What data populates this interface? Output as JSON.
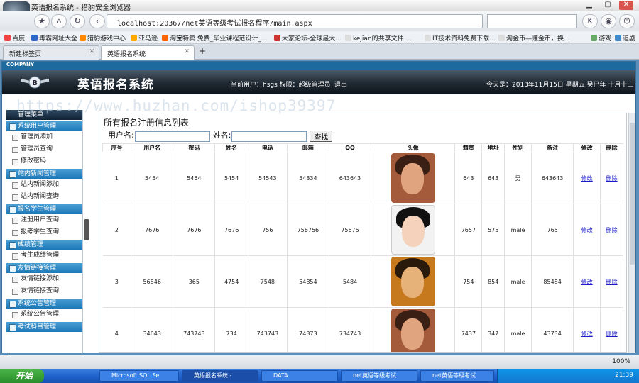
{
  "browser": {
    "window_title": "英语报名系统 - 猎豹安全浏览器",
    "url": "localhost:20367/net英语等级考试报名程序/main.aspx",
    "bookmarks": [
      "百度",
      "毒霸网址大全",
      "猎豹游戏中心",
      "亚马逊",
      "淘宝特卖 免费_毕业课程范设计_...",
      "大家论坛-全球最大...",
      "kejian的共享文件 ...",
      "IT技术资料免费下载...",
      "淘金币—赚金币，换...",
      "游戏",
      "追剧"
    ],
    "tabs": [
      {
        "label": "新建标签页",
        "active": false
      },
      {
        "label": "英语报名系统",
        "active": true
      }
    ],
    "zoom": "100%"
  },
  "app": {
    "brand_bar": "COMPANY",
    "title": "英语报名系统",
    "current_user": "当前用户：hsgs 权限：超级管理员",
    "logout": "退出",
    "date": "今天是：2013年11月15日 星期五 癸巳年 十月十三",
    "watermark": "https://www.huzhan.com/ishop39397"
  },
  "sidebar": {
    "title": "管理菜单",
    "sections": [
      {
        "title": "系统用户管理",
        "items": [
          "管理员添加",
          "管理员查询",
          "修改密码"
        ]
      },
      {
        "title": "站内新闻管理",
        "items": [
          "站内新闻添加",
          "站内新闻查询"
        ]
      },
      {
        "title": "报名学生管理",
        "items": [
          "注册用户查询",
          "报考学生查询"
        ]
      },
      {
        "title": "成绩管理",
        "items": [
          "考生成绩管理"
        ]
      },
      {
        "title": "友情链接管理",
        "items": [
          "友情链接添加",
          "友情链接查询"
        ]
      },
      {
        "title": "系统公告管理",
        "items": [
          "系统公告管理"
        ]
      },
      {
        "title": "考试科目管理",
        "items": []
      }
    ]
  },
  "main": {
    "heading": "所有报名注册信息列表",
    "search": {
      "username_label": "用户名:",
      "name_label": "姓名:",
      "button": "查找"
    },
    "columns": [
      "序号",
      "用户名",
      "密码",
      "姓名",
      "电话",
      "邮箱",
      "QQ",
      "头像",
      "籍贯",
      "地址",
      "性别",
      "备注",
      "修改",
      "删除"
    ],
    "rows": [
      [
        "1",
        "5454",
        "5454",
        "5454",
        "54543",
        "54334",
        "643643",
        "",
        "643",
        "643",
        "男",
        "643643",
        "修改",
        "删除"
      ],
      [
        "2",
        "7676",
        "7676",
        "7676",
        "756",
        "756756",
        "75675",
        "",
        "7657",
        "575",
        "male",
        "765",
        "修改",
        "删除"
      ],
      [
        "3",
        "56846",
        "365",
        "4754",
        "7548",
        "54854",
        "5484",
        "",
        "754",
        "854",
        "male",
        "85484",
        "修改",
        "删除"
      ],
      [
        "4",
        "34643",
        "743743",
        "734",
        "743743",
        "74373",
        "734743",
        "",
        "7437",
        "347",
        "male",
        "43734",
        "修改",
        "删除"
      ]
    ]
  },
  "taskbar": {
    "start": "开始",
    "items": [
      "Microsoft SQL Se",
      "英语报名系统 -",
      "DATA",
      "net英语等级考试",
      "net英语等级考试"
    ],
    "clock": "21:39"
  },
  "colors": {
    "accent": "#1b78b8",
    "header_dark": "#222c36",
    "link": "#1b1bc9"
  }
}
